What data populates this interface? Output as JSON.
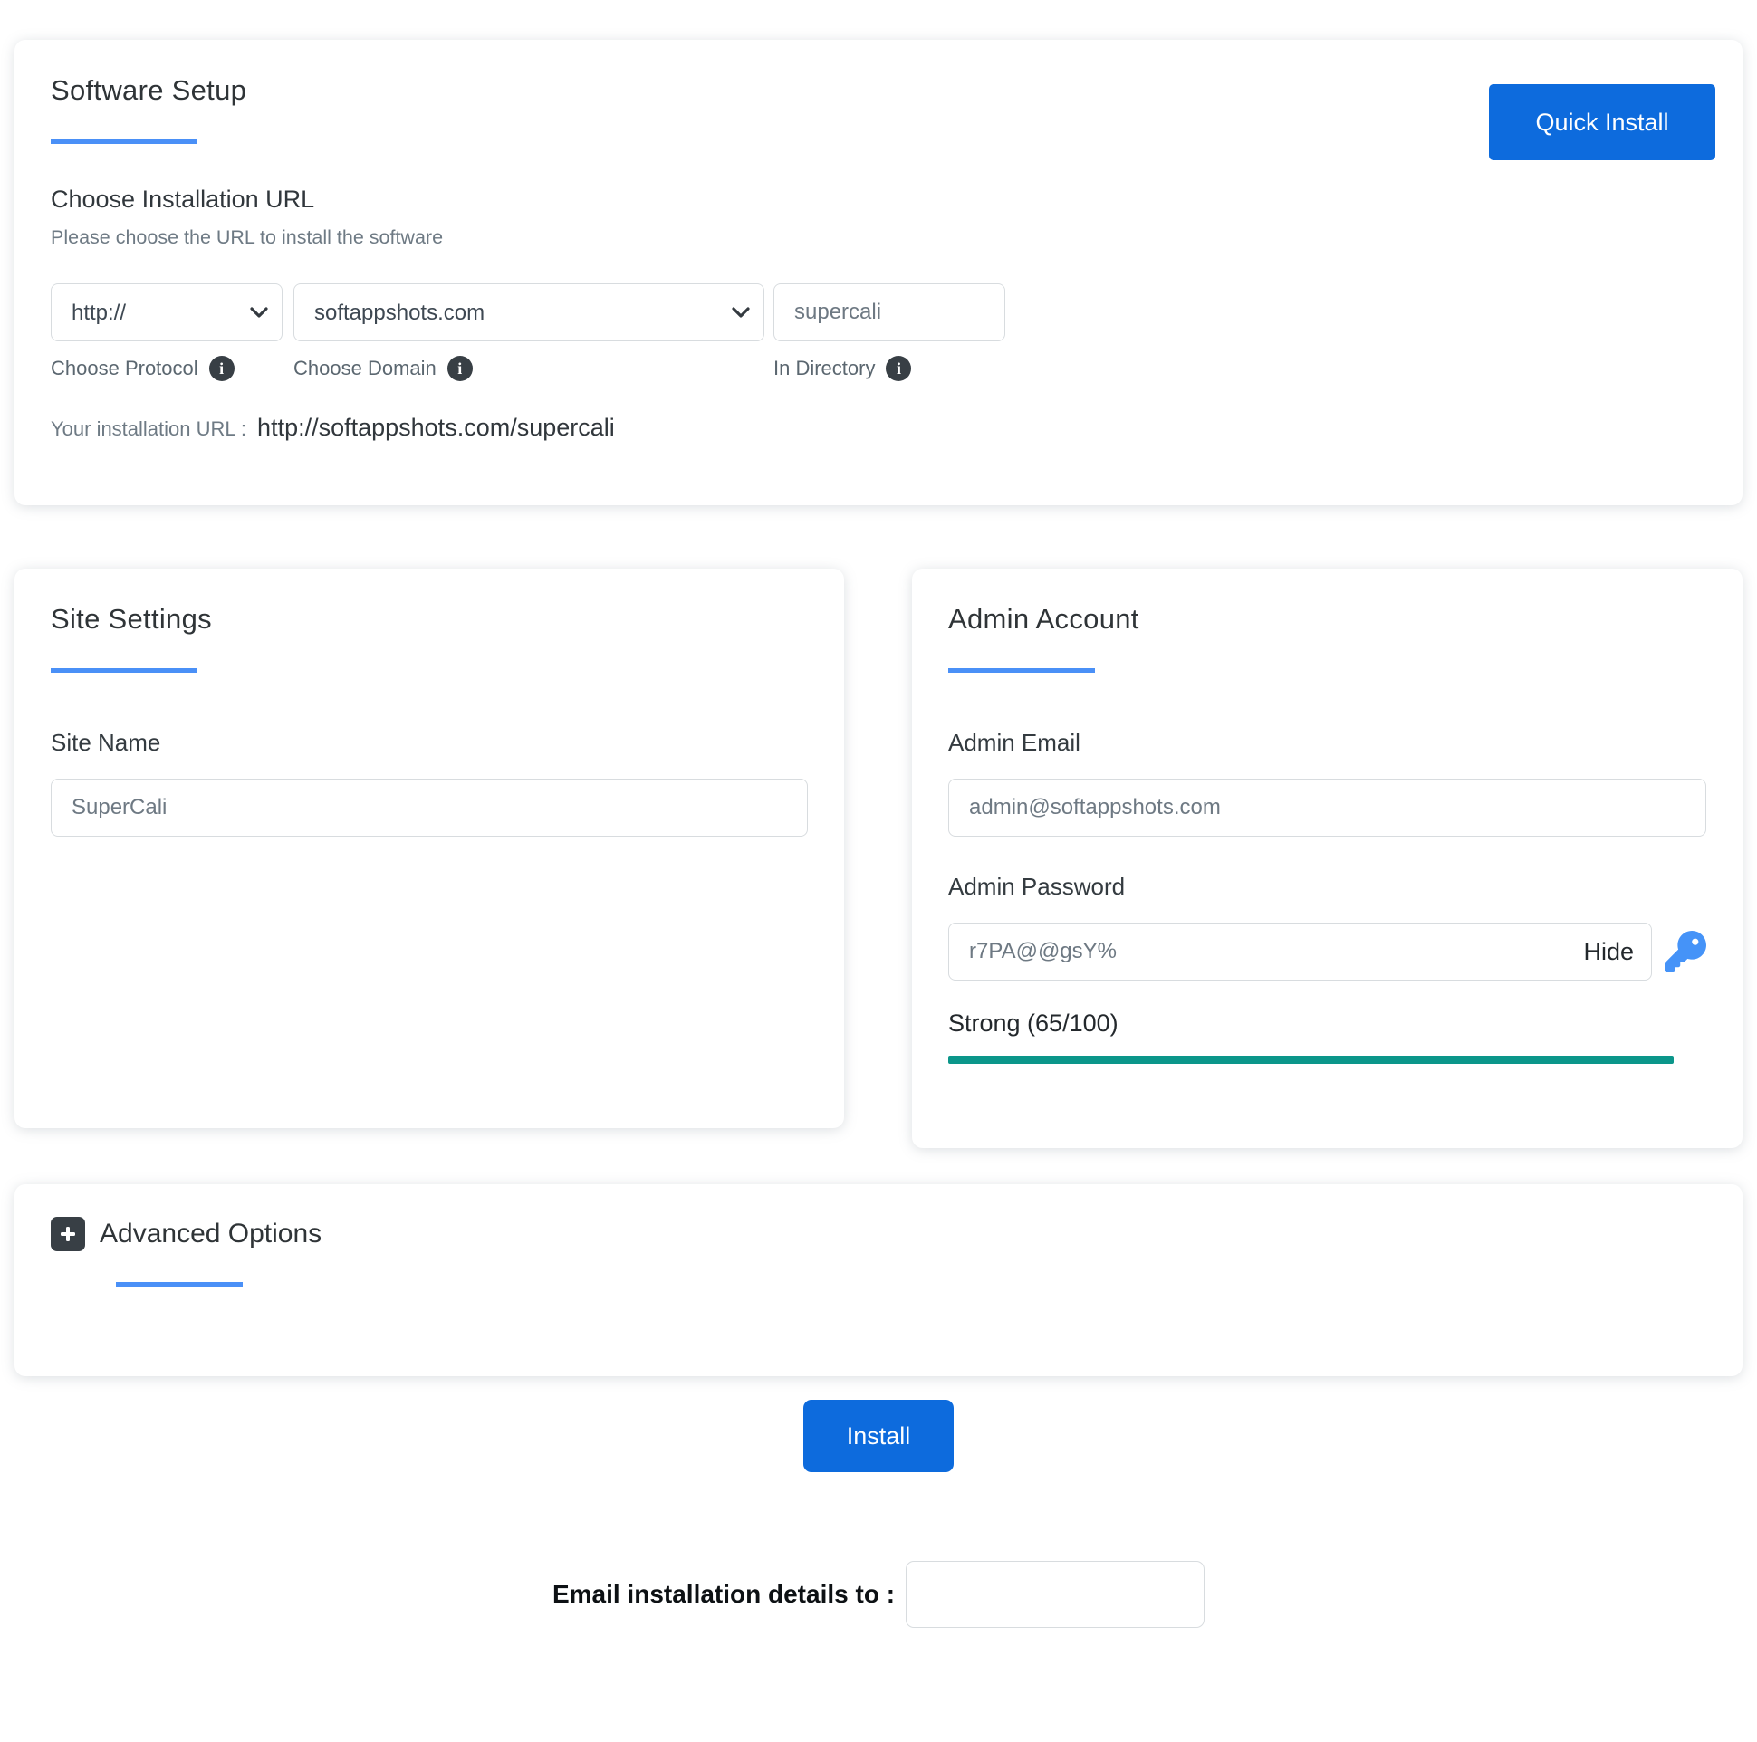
{
  "colors": {
    "accent_blue": "#4a90f7",
    "button_blue": "#0d6bdd",
    "strength_teal": "#0b968a",
    "icon_dark": "#383f45"
  },
  "icons": {
    "info_glyph": "i"
  },
  "software_setup": {
    "title": "Software Setup",
    "quick_install_label": "Quick Install",
    "url_section": {
      "title": "Choose Installation URL",
      "subtitle": "Please choose the URL to install the software",
      "protocol_value": "http://",
      "protocol_label": "Choose Protocol",
      "domain_value": "softappshots.com",
      "domain_label": "Choose Domain",
      "directory_value": "supercali",
      "directory_label": "In Directory",
      "installation_url_label": "Your installation URL :",
      "installation_url": "http://softappshots.com/supercali"
    }
  },
  "site_settings": {
    "title": "Site Settings",
    "site_name_label": "Site Name",
    "site_name_value": "SuperCali"
  },
  "admin_account": {
    "title": "Admin Account",
    "email_label": "Admin Email",
    "email_value": "admin@softappshots.com",
    "password_label": "Admin Password",
    "password_value": "r7PA@@gsY%",
    "hide_label": "Hide",
    "strength_text": "Strong (65/100)",
    "strength_score": "65/100"
  },
  "advanced_options": {
    "title": "Advanced Options"
  },
  "install": {
    "button_label": "Install"
  },
  "email_details": {
    "label": "Email installation details to :",
    "value": ""
  }
}
